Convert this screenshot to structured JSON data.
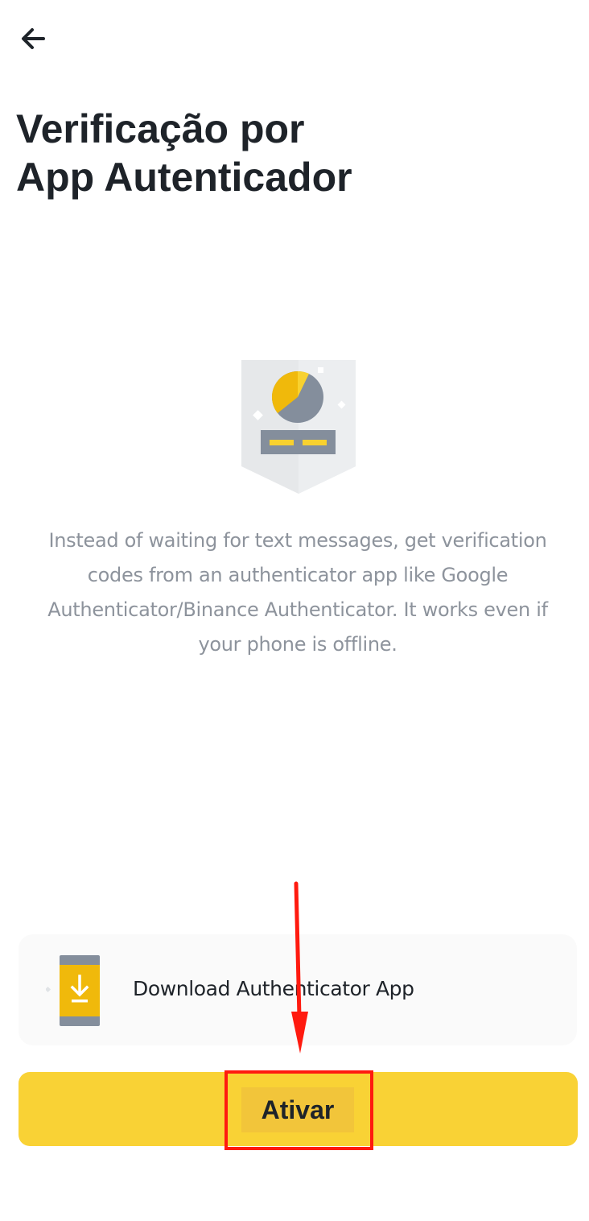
{
  "header": {
    "back_icon": "arrow-left-icon",
    "title_line1": "Verificação por",
    "title_line2": "App Autenticador"
  },
  "illustration": {
    "icon": "authenticator-shield-icon",
    "colors": {
      "shield": "#e6e8ea",
      "shield_shade": "#f5f5f5",
      "pie_yellow": "#f0b90b",
      "pie_gray": "#848e9c",
      "bar": "#848e9c",
      "bar_dashes": "#f8d12f"
    }
  },
  "description": "Instead of waiting for text messages, get verification codes from an authenticator app like Google Authenticator/Binance Authenticator. It works even if your phone is offline.",
  "download_card": {
    "icon": "phone-download-icon",
    "label": "Download Authenticator App"
  },
  "primary_button": {
    "label": "Ativar"
  },
  "annotation": {
    "type": "arrow-and-highlight-box",
    "color": "#ff1a0f"
  },
  "theme": {
    "accent": "#f9d235",
    "text_primary": "#1e2329",
    "text_secondary": "#8d939c",
    "card_background": "#fafafa"
  }
}
